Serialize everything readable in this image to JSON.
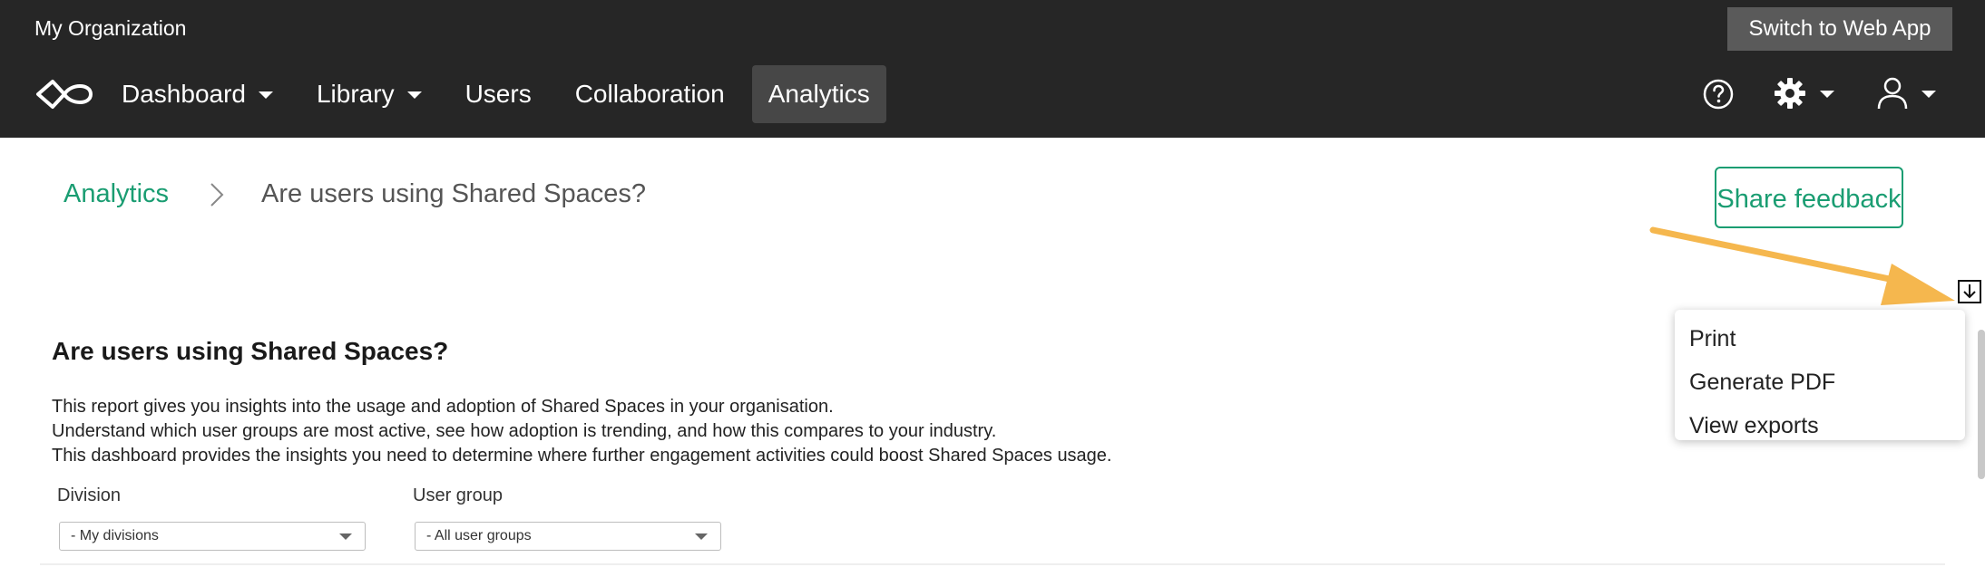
{
  "header": {
    "org_name": "My Organization",
    "switch_label": "Switch to Web App",
    "nav": [
      {
        "label": "Dashboard",
        "has_dropdown": true,
        "active": false
      },
      {
        "label": "Library",
        "has_dropdown": true,
        "active": false
      },
      {
        "label": "Users",
        "has_dropdown": false,
        "active": false
      },
      {
        "label": "Collaboration",
        "has_dropdown": false,
        "active": false
      },
      {
        "label": "Analytics",
        "has_dropdown": false,
        "active": true
      }
    ],
    "icons": {
      "logo": "infinity-logo-icon",
      "help": "help-icon",
      "settings": "gear-icon",
      "user": "user-icon"
    }
  },
  "breadcrumb": {
    "root": "Analytics",
    "current": "Are users using Shared Spaces?"
  },
  "feedback_label": "Share feedback",
  "export_menu": {
    "icon": "download-icon",
    "items": [
      "Print",
      "Generate PDF",
      "View exports"
    ]
  },
  "report": {
    "title": "Are users using Shared Spaces?",
    "description": [
      "This report gives you insights into the usage and adoption of Shared Spaces in your organisation.",
      "Understand which user groups are most active, see how adoption is trending, and how this compares to your industry.",
      "This dashboard provides the insights you need to determine where further engagement activities could boost Shared Spaces usage."
    ],
    "filters": {
      "division": {
        "label": "Division",
        "value": "- My divisions"
      },
      "user_group": {
        "label": "User group",
        "value": "- All user groups"
      }
    }
  },
  "colors": {
    "topbar": "#262626",
    "accent": "#1a9d72",
    "arrow": "#f5b74e"
  }
}
